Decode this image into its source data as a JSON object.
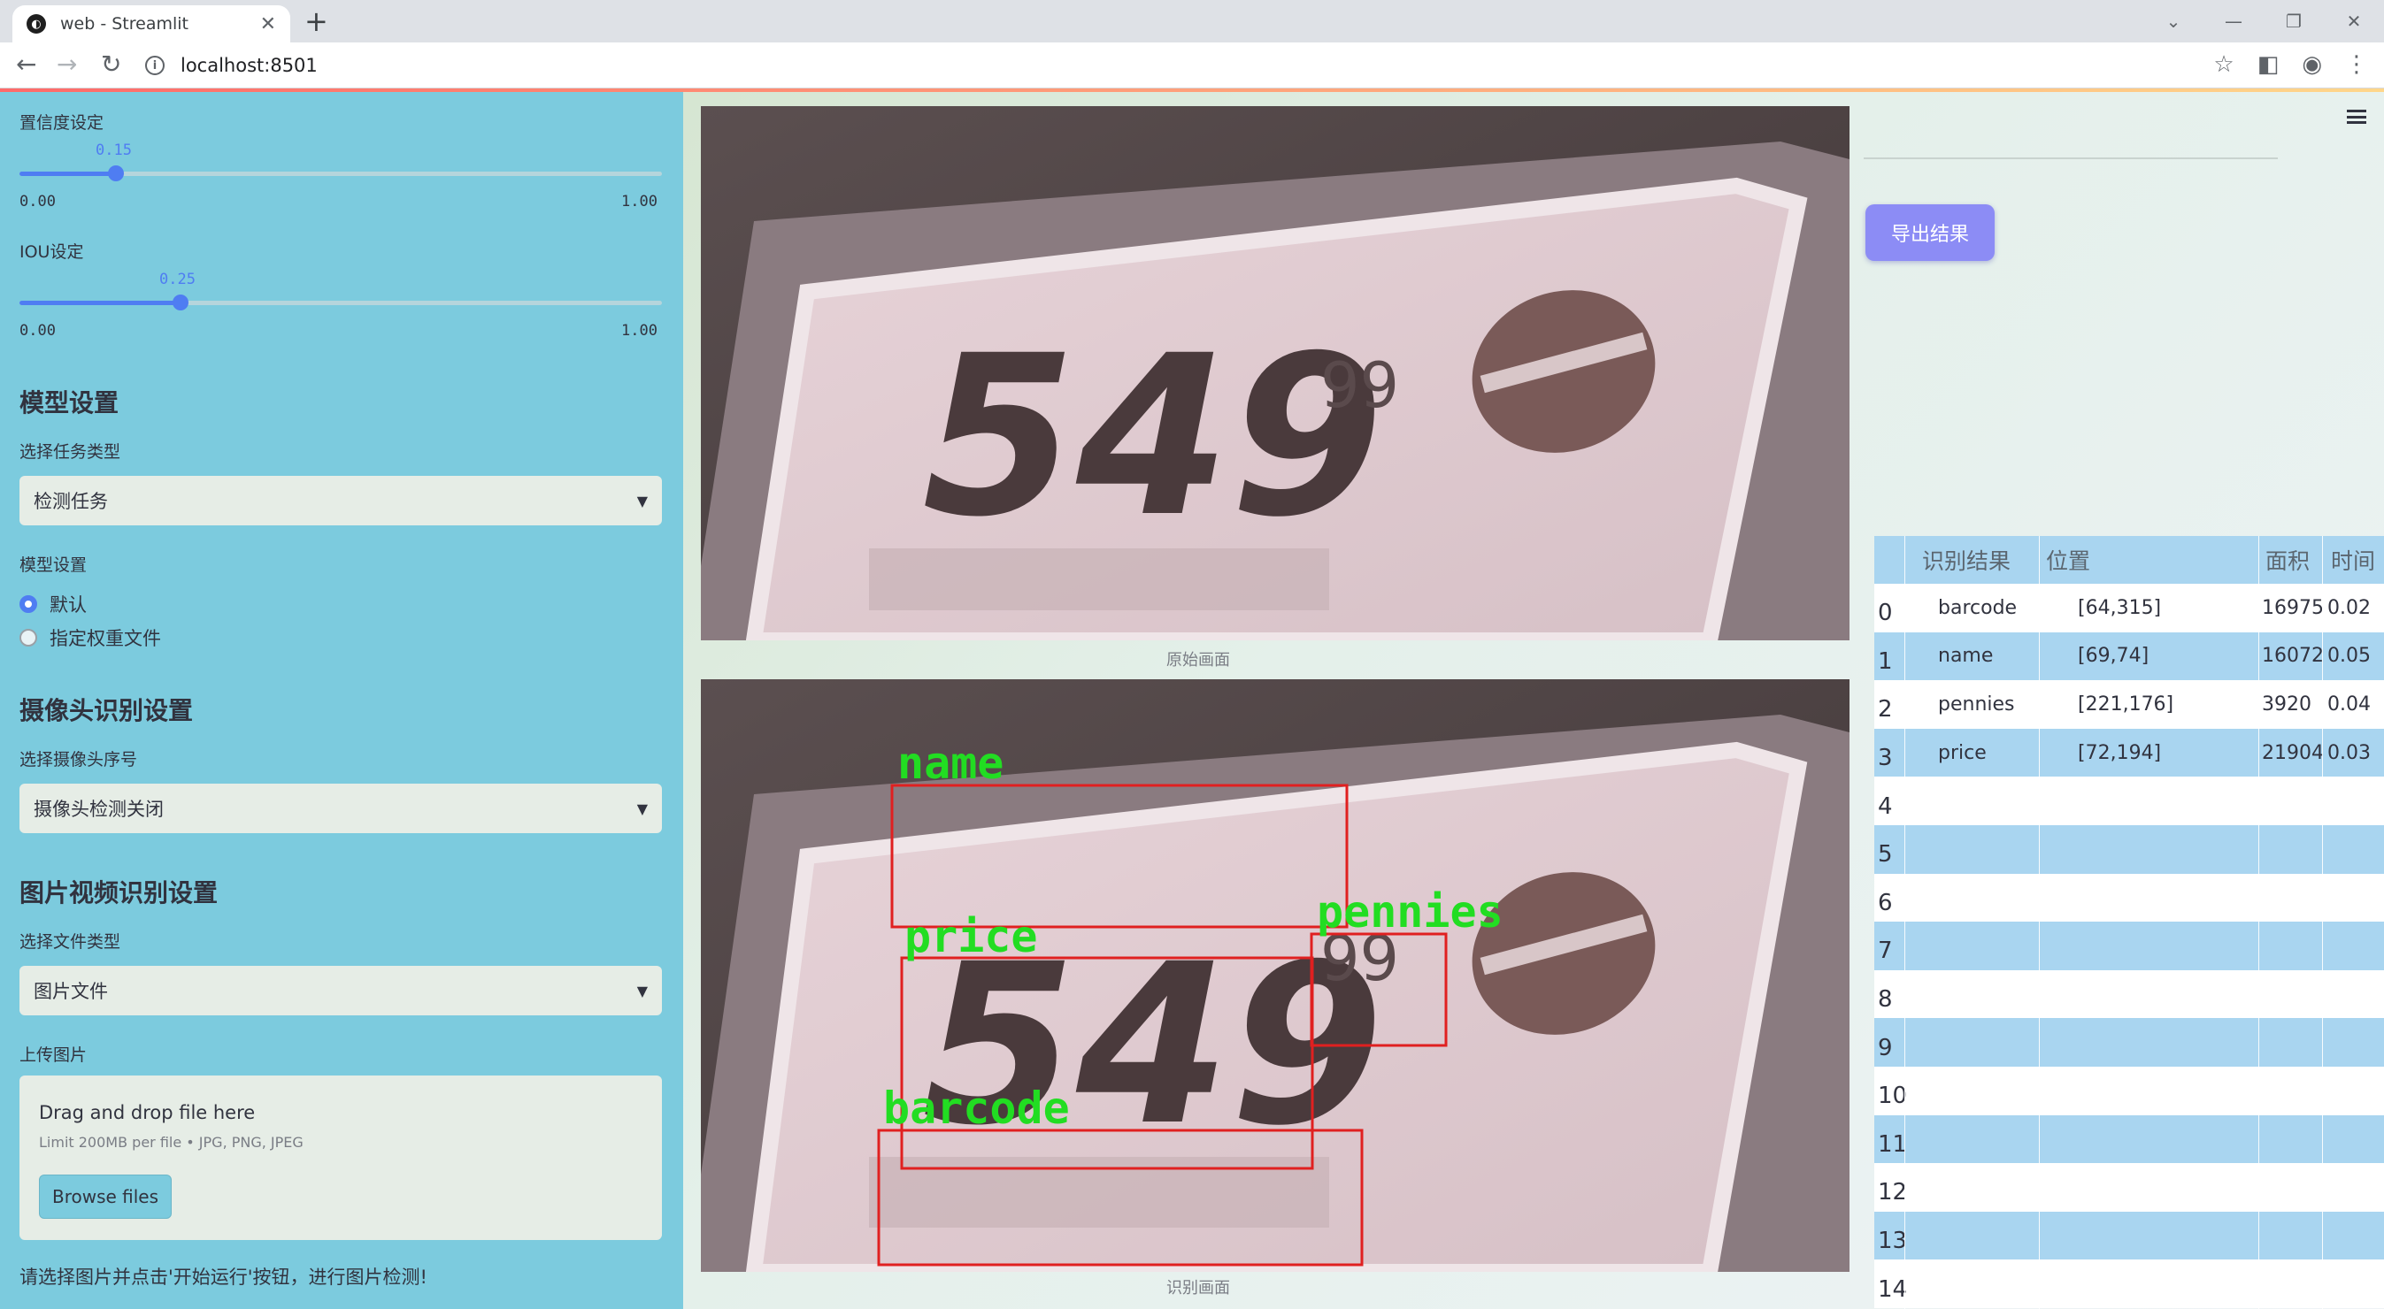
{
  "browser": {
    "tab_title": "web - Streamlit",
    "url": "localhost:8501"
  },
  "sidebar": {
    "confidence": {
      "label": "置信度设定",
      "value": "0.15",
      "min": "0.00",
      "max": "1.00",
      "fraction": 0.15
    },
    "iou": {
      "label": "IOU设定",
      "value": "0.25",
      "min": "0.00",
      "max": "1.00",
      "fraction": 0.25
    },
    "model_section": {
      "heading": "模型设置",
      "task_label": "选择任务类型",
      "task_value": "检测任务",
      "model_label": "模型设置",
      "options": [
        "默认",
        "指定权重文件"
      ],
      "selected_index": 0
    },
    "camera_section": {
      "heading": "摄像头识别设置",
      "camera_label": "选择摄像头序号",
      "camera_value": "摄像头检测关闭"
    },
    "media_section": {
      "heading": "图片视频识别设置",
      "file_type_label": "选择文件类型",
      "file_type_value": "图片文件",
      "upload_label": "上传图片",
      "drop_text": "Drag and drop file here",
      "limit_text": "Limit 200MB per file • JPG, PNG, JPEG",
      "browse_label": "Browse files"
    },
    "footer_text": "请选择图片并点击'开始运行'按钮，进行图片检测!"
  },
  "main": {
    "original_caption": "原始画面",
    "result_caption": "识别画面",
    "export_label": "导出结果",
    "price_text": "549",
    "detections": [
      {
        "label": "name"
      },
      {
        "label": "price"
      },
      {
        "label": "pennies"
      },
      {
        "label": "barcode"
      }
    ],
    "label_color": "#22dd22",
    "box_color": "#e02020"
  },
  "table": {
    "headers": [
      "识别结果",
      "位置",
      "面积",
      "时间"
    ],
    "rows": [
      {
        "index": "0",
        "label": "barcode",
        "pos": "[64,315]",
        "area": "16975",
        "time": "0.02"
      },
      {
        "index": "1",
        "label": "name",
        "pos": "[69,74]",
        "area": "16072",
        "time": "0.05"
      },
      {
        "index": "2",
        "label": "pennies",
        "pos": "[221,176]",
        "area": "3920",
        "time": "0.04"
      },
      {
        "index": "3",
        "label": "price",
        "pos": "[72,194]",
        "area": "21904",
        "time": "0.03"
      },
      {
        "index": "4",
        "label": "",
        "pos": "",
        "area": "",
        "time": ""
      },
      {
        "index": "5",
        "label": "",
        "pos": "",
        "area": "",
        "time": ""
      },
      {
        "index": "6",
        "label": "",
        "pos": "",
        "area": "",
        "time": ""
      },
      {
        "index": "7",
        "label": "",
        "pos": "",
        "area": "",
        "time": ""
      },
      {
        "index": "8",
        "label": "",
        "pos": "",
        "area": "",
        "time": ""
      },
      {
        "index": "9",
        "label": "",
        "pos": "",
        "area": "",
        "time": ""
      },
      {
        "index": "10",
        "label": "",
        "pos": "",
        "area": "",
        "time": ""
      },
      {
        "index": "11",
        "label": "",
        "pos": "",
        "area": "",
        "time": ""
      },
      {
        "index": "12",
        "label": "",
        "pos": "",
        "area": "",
        "time": ""
      },
      {
        "index": "13",
        "label": "",
        "pos": "",
        "area": "",
        "time": ""
      },
      {
        "index": "14",
        "label": "",
        "pos": "",
        "area": "",
        "time": ""
      }
    ]
  }
}
